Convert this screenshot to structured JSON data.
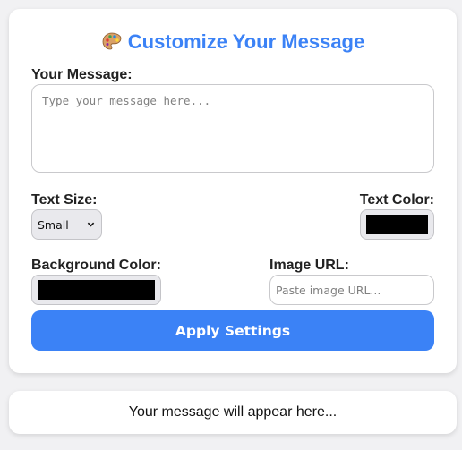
{
  "header": {
    "title": "Customize Your Message",
    "icon": "palette-icon"
  },
  "message": {
    "label": "Your Message:",
    "placeholder": "Type your message here...",
    "value": ""
  },
  "text_size": {
    "label": "Text Size:",
    "selected": "Small"
  },
  "text_color": {
    "label": "Text Color:",
    "value": "#000000"
  },
  "background_color": {
    "label": "Background Color:",
    "value": "#000000"
  },
  "image_url": {
    "label": "Image URL:",
    "placeholder": "Paste image URL..."
  },
  "apply_button": {
    "label": "Apply Settings"
  },
  "preview": {
    "text": "Your message will appear here..."
  },
  "colors": {
    "accent": "#3b82f6",
    "page_bg": "#f1f1f3",
    "card_bg": "#ffffff"
  }
}
